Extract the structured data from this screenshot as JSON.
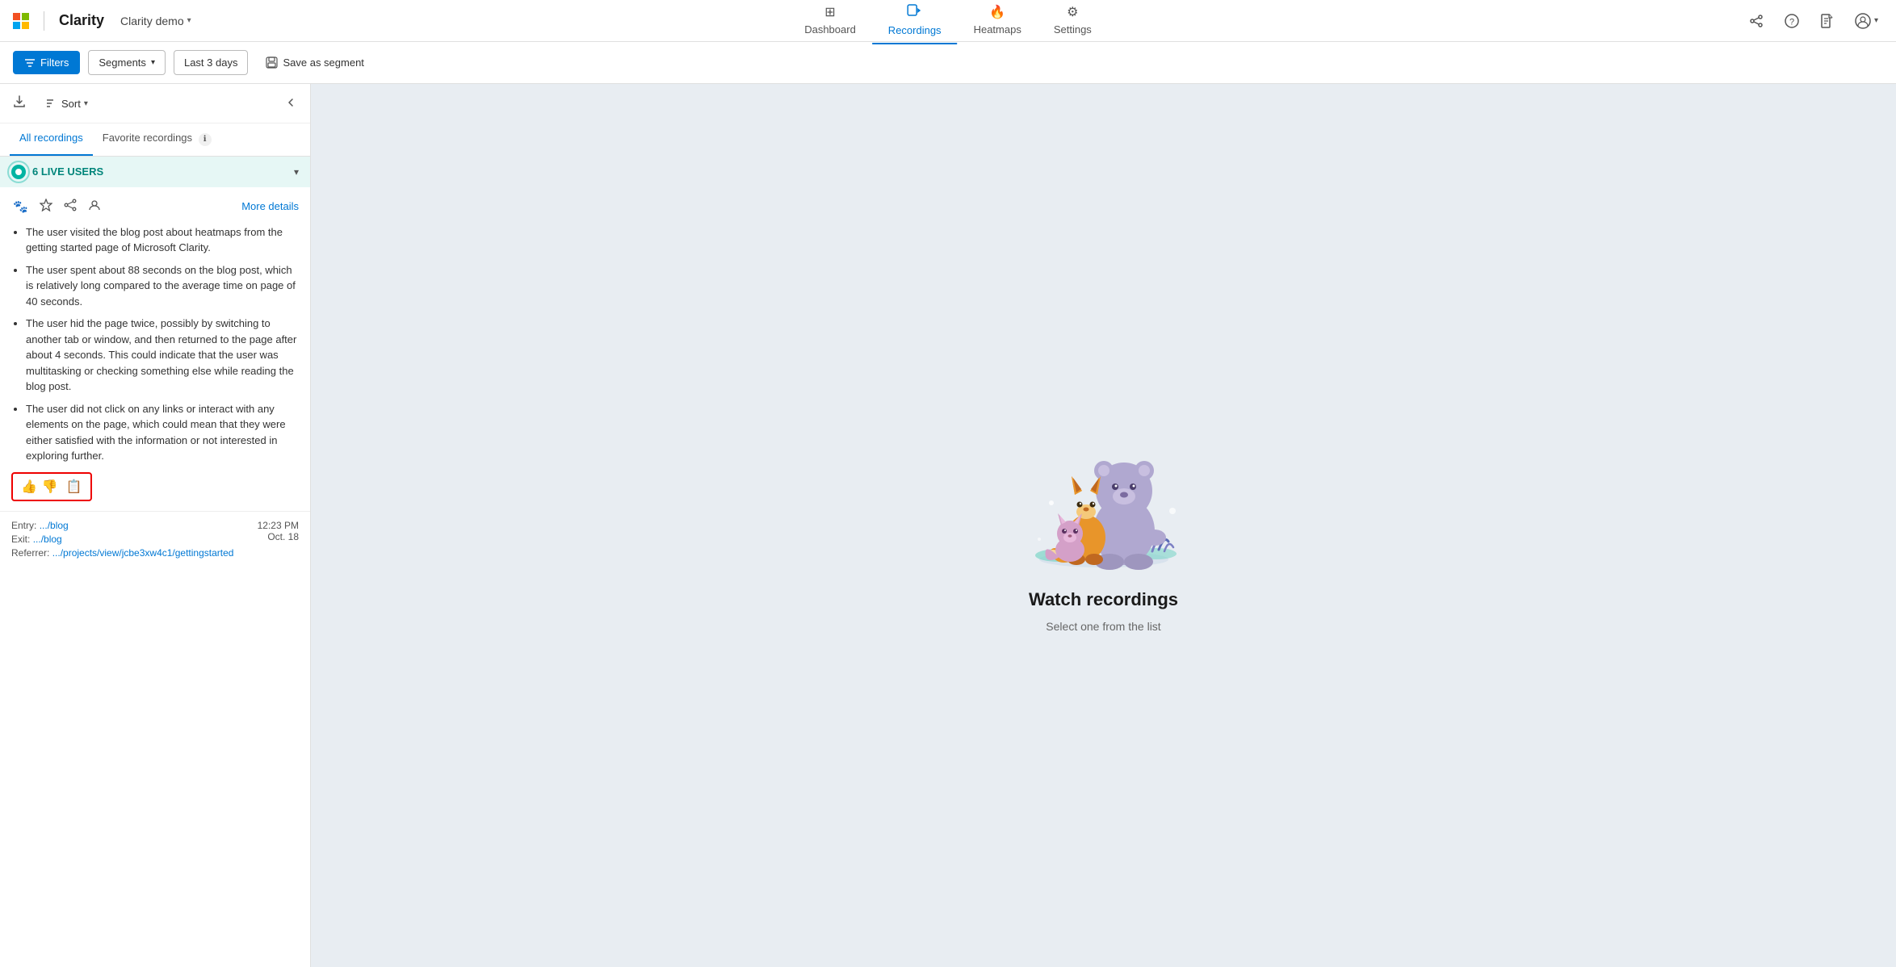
{
  "topnav": {
    "brand": "Clarity",
    "project": "Clarity demo",
    "nav_items": [
      {
        "id": "dashboard",
        "label": "Dashboard",
        "icon": "⊞",
        "active": false
      },
      {
        "id": "recordings",
        "label": "Recordings",
        "icon": "🎬",
        "active": true
      },
      {
        "id": "heatmaps",
        "label": "Heatmaps",
        "icon": "🔥",
        "active": false
      },
      {
        "id": "settings",
        "label": "Settings",
        "icon": "⚙",
        "active": false
      }
    ]
  },
  "toolbar": {
    "filters_label": "Filters",
    "segments_label": "Segments",
    "days_label": "Last 3 days",
    "save_label": "Save as segment"
  },
  "sidebar": {
    "download_title": "Download",
    "sort_label": "Sort",
    "collapse_label": "Collapse",
    "tabs": [
      {
        "id": "all",
        "label": "All recordings",
        "badge": null,
        "active": true
      },
      {
        "id": "favorite",
        "label": "Favorite recordings",
        "badge": "ℹ",
        "active": false
      }
    ],
    "live_users": {
      "label": "6 LIVE USERS"
    },
    "recording_card": {
      "bullets": [
        "The user visited the blog post about heatmaps from the getting started page of Microsoft Clarity.",
        "The user spent about 88 seconds on the blog post, which is relatively long compared to the average time on page of 40 seconds.",
        "The user hid the page twice, possibly by switching to another tab or window, and then returned to the page after about 4 seconds. This could indicate that the user was multitasking or checking something else while reading the blog post.",
        "The user did not click on any links or interact with any elements on the page, which could mean that they were either satisfied with the information or not interested in exploring further."
      ],
      "entry_label": "Entry:",
      "entry_path": ".../blog",
      "exit_label": "Exit:",
      "exit_path": ".../blog",
      "referrer_label": "Referrer:",
      "referrer_path": ".../projects/view/jcbe3xw4c1/gettingstarted",
      "time": "12:23 PM",
      "date": "Oct. 18",
      "more_details": "More details"
    }
  },
  "main": {
    "watch_title": "Watch recordings",
    "watch_subtitle": "Select one from the list"
  }
}
